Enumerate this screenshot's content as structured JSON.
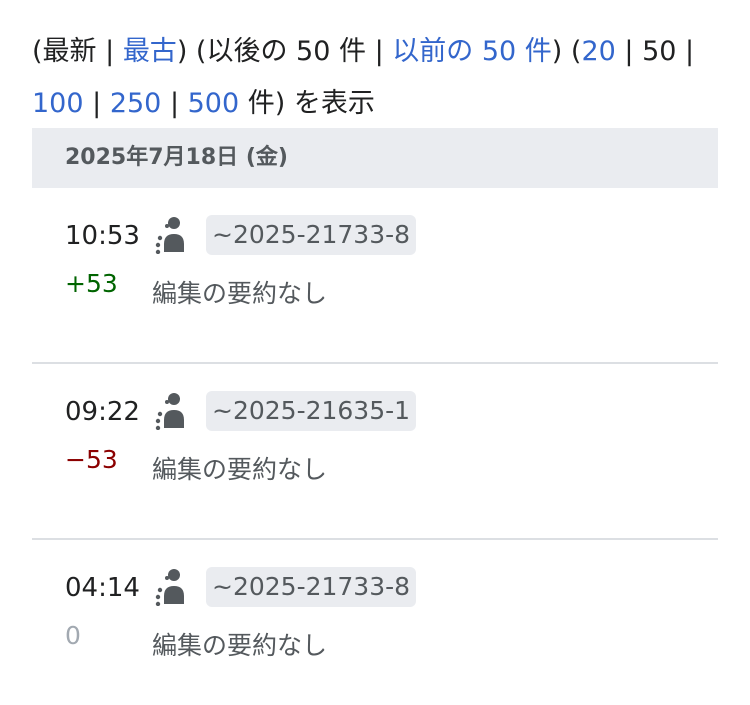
{
  "nav": {
    "open1": "(",
    "newest": "最新",
    "sep1": " | ",
    "oldest": "最古",
    "close1": ") (",
    "later": "以後の 50 件",
    "sep2": " | ",
    "earlier": "以前の 50 件",
    "close2": ") (",
    "opt20": "20",
    "sep3": " | ",
    "opt50": "50",
    "sep4": " | ",
    "opt100": "100",
    "sep5": " | ",
    "opt250": "250",
    "sep6": " | ",
    "opt500": "500",
    "suffix": " 件) を表示"
  },
  "date_header": "2025年7月18日 (金)",
  "entries": [
    {
      "time": "10:53",
      "user": "~2025-21733-8",
      "diff": "+53",
      "summary": "編集の要約なし"
    },
    {
      "time": "09:22",
      "user": "~2025-21635-1",
      "diff": "−53",
      "summary": "編集の要約なし"
    },
    {
      "time": "04:14",
      "user": "~2025-21733-8",
      "diff": "0",
      "summary": "編集の要約なし"
    }
  ],
  "colors": {
    "link": "#3366cc",
    "positive": "#006400",
    "negative": "#8b0000",
    "neutral": "#a2a9b1",
    "header_bg": "#eaecf0"
  },
  "icons": {
    "anon_user": "temporary-account-icon"
  }
}
